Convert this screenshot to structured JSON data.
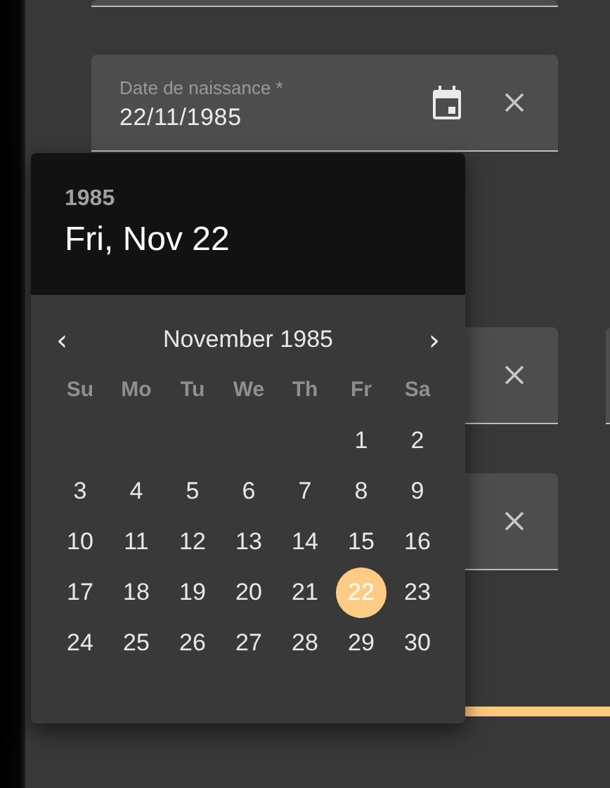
{
  "form": {
    "date_field": {
      "label": "Date de naissance *",
      "value": "22/11/1985",
      "clearable": true
    },
    "covered_fields": [
      {
        "clearable": true
      },
      {
        "clearable": true
      }
    ],
    "progress": {
      "level": 1
    }
  },
  "date_picker": {
    "year": "1985",
    "date": "Fri, Nov 22",
    "prev": "‹",
    "next": "›",
    "month": "November 1985",
    "weekdays": [
      "Su",
      "Mo",
      "Tu",
      "We",
      "Th",
      "Fr",
      "Sa"
    ],
    "weeks": [
      [
        {
          "day": "1",
          "selected": false
        },
        {
          "day": "2",
          "selected": false
        }
      ],
      [
        {
          "day": "3",
          "selected": false
        },
        {
          "day": "4",
          "selected": false
        },
        {
          "day": "5",
          "selected": false
        },
        {
          "day": "6",
          "selected": false
        },
        {
          "day": "7",
          "selected": false
        },
        {
          "day": "8",
          "selected": false
        },
        {
          "day": "9",
          "selected": false
        }
      ],
      [
        {
          "day": "10",
          "selected": false
        },
        {
          "day": "11",
          "selected": false
        },
        {
          "day": "12",
          "selected": false
        },
        {
          "day": "13",
          "selected": false
        },
        {
          "day": "14",
          "selected": false
        },
        {
          "day": "15",
          "selected": false
        },
        {
          "day": "16",
          "selected": false
        }
      ],
      [
        {
          "day": "17",
          "selected": false
        },
        {
          "day": "18",
          "selected": false
        },
        {
          "day": "19",
          "selected": false
        },
        {
          "day": "20",
          "selected": false
        },
        {
          "day": "21",
          "selected": false
        },
        {
          "day": "22",
          "selected": true
        },
        {
          "day": "23",
          "selected": false
        }
      ],
      [
        {
          "day": "24",
          "selected": false
        },
        {
          "day": "25",
          "selected": false
        },
        {
          "day": "26",
          "selected": false
        },
        {
          "day": "27",
          "selected": false
        },
        {
          "day": "28",
          "selected": false
        },
        {
          "day": "29",
          "selected": false
        },
        {
          "day": "30",
          "selected": false
        }
      ]
    ]
  }
}
